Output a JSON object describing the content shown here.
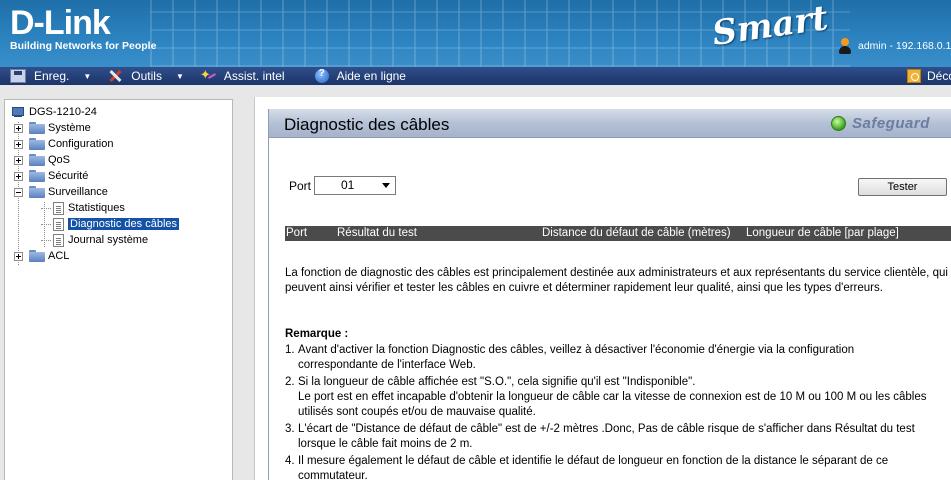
{
  "header": {
    "brand": "D-Link",
    "tagline": "Building Networks for People",
    "product_logo": "Smart",
    "user_info": "admin - 192.168.0.1"
  },
  "menubar": {
    "save": "Enreg.",
    "tools": "Outils",
    "wizard": "Assist. intel",
    "help": "Aide en ligne",
    "logout": "Déconnexion"
  },
  "tree": {
    "root": "DGS-1210-24",
    "items": [
      {
        "label": "Système"
      },
      {
        "label": "Configuration"
      },
      {
        "label": "QoS"
      },
      {
        "label": "Sécurité"
      },
      {
        "label": "Surveillance"
      }
    ],
    "surveillance_children": [
      {
        "label": "Statistiques"
      },
      {
        "label": "Diagnostic des câbles"
      },
      {
        "label": "Journal système"
      }
    ],
    "acl": "ACL"
  },
  "panel": {
    "title": "Diagnostic des câbles",
    "safeguard": "Safeguard",
    "port_label": "Port",
    "port_value": "01",
    "test_button": "Tester",
    "columns": [
      "Port",
      "Résultat du test",
      "Distance du défaut de câble (mètres)",
      "Longueur de câble [par plage]"
    ],
    "description": "La fonction de diagnostic des câbles est principalement destinée aux administrateurs et aux représentants du service clientèle, qui peuvent ainsi vérifier et tester les câbles en cuivre et déterminer rapidement leur qualité, ainsi que les types d'erreurs.",
    "remark_title": "Remarque :",
    "remarks": [
      {
        "num": "1.",
        "lines": [
          "Avant d'activer la fonction Diagnostic des câbles, veillez à désactiver l'économie d'énergie via la configuration",
          "correspondante de l'interface Web."
        ]
      },
      {
        "num": "2.",
        "lines": [
          "Si la longueur de câble affichée est \"S.O.\", cela signifie qu'il est \"Indisponible\".",
          "Le port est en effet incapable d'obtenir la longueur de câble car la vitesse de connexion est de 10 M ou 100 M ou les câbles",
          "utilisés sont coupés et/ou de mauvaise qualité."
        ]
      },
      {
        "num": "3.",
        "lines": [
          "L'écart de \"Distance de défaut de câble\" est de +/-2 mètres .Donc, Pas de câble risque de s'afficher dans Résultat du test",
          "lorsque le câble fait moins de 2 m."
        ]
      },
      {
        "num": "4.",
        "lines": [
          "Il mesure également le défaut de câble et identifie le défaut de longueur en fonction de la distance le séparant de ce",
          "commutateur."
        ]
      }
    ]
  }
}
